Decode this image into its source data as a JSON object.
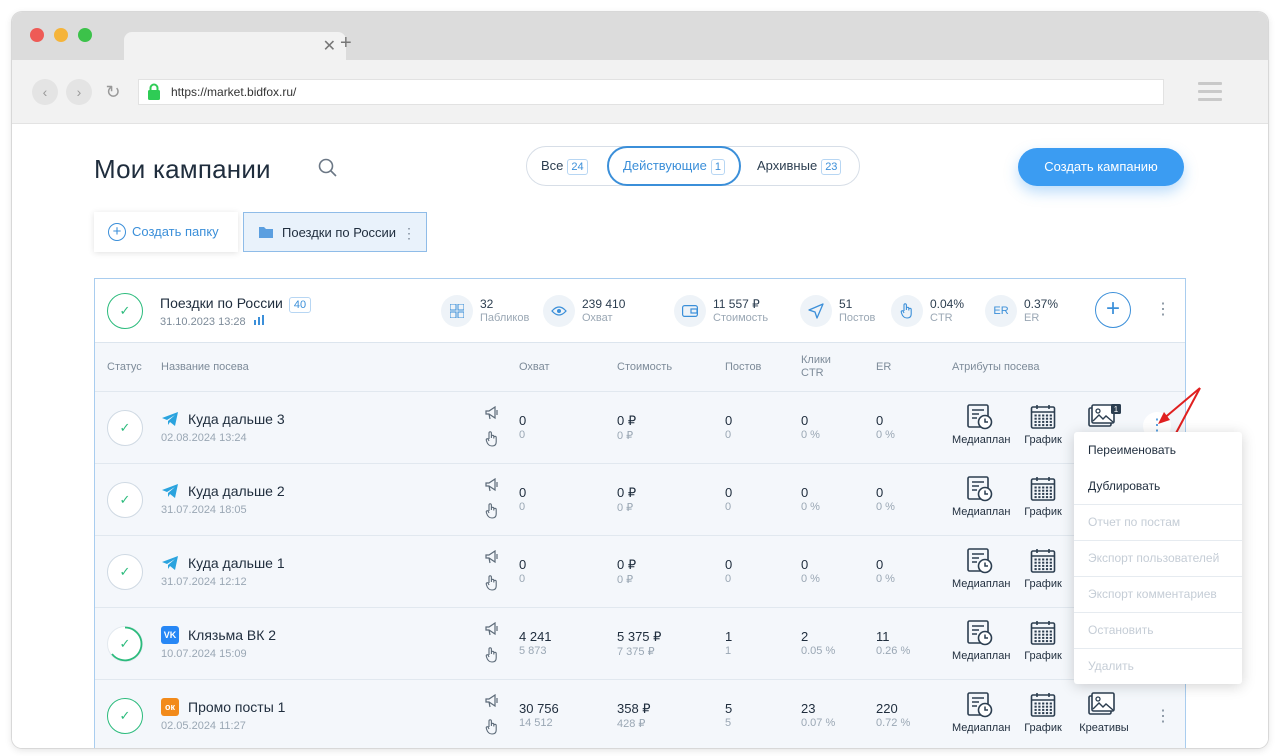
{
  "browser": {
    "url": "https://market.bidfox.ru/"
  },
  "header": {
    "title": "Мои кампании",
    "filters": [
      {
        "label": "Все",
        "count": "24"
      },
      {
        "label": "Действующие",
        "count": "1"
      },
      {
        "label": "Архивные",
        "count": "23"
      }
    ],
    "create_button": "Создать кампанию"
  },
  "folders": {
    "create_label": "Создать папку",
    "folder_label": "Поездки по России"
  },
  "campaign": {
    "name": "Поездки по России",
    "count": "40",
    "date": "31.10.2023 13:28",
    "stats": [
      {
        "icon": "grid-icon",
        "value": "32",
        "label": "Пабликов"
      },
      {
        "icon": "eye-icon",
        "value": "239 410",
        "label": "Охват"
      },
      {
        "icon": "wallet-icon",
        "value": "11 557 ₽",
        "label": "Стоимость"
      },
      {
        "icon": "send-icon",
        "value": "51",
        "label": "Постов"
      },
      {
        "icon": "hand-icon",
        "value": "0.04%",
        "label": "CTR"
      },
      {
        "icon": "er-icon",
        "value": "0.37%",
        "label": "ER",
        "badge": "ER"
      }
    ]
  },
  "table": {
    "headers": {
      "status": "Статус",
      "name": "Название посева",
      "reach": "Охват",
      "cost": "Стоимость",
      "posts": "Постов",
      "clicks": "Клики",
      "ctr": "CTR",
      "er": "ER",
      "attrs": "Атрибуты посева"
    },
    "attr_labels": {
      "mediaplan": "Медиаплан",
      "schedule": "График",
      "creatives": "Креативы"
    },
    "rows": [
      {
        "name": "Куда дальше 3",
        "date": "02.08.2024 13:24",
        "platform": "telegram",
        "reach": "0",
        "reach_sub": "0",
        "cost": "0 ₽",
        "cost_sub": "0 ₽",
        "posts": "0",
        "posts_sub": "0",
        "clicks": "0",
        "clicks_sub": "0 %",
        "er": "0",
        "er_sub": "0 %",
        "creatives_badge": "1"
      },
      {
        "name": "Куда дальше 2",
        "date": "31.07.2024 18:05",
        "platform": "telegram",
        "reach": "0",
        "reach_sub": "0",
        "cost": "0 ₽",
        "cost_sub": "0 ₽",
        "posts": "0",
        "posts_sub": "0",
        "clicks": "0",
        "clicks_sub": "0 %",
        "er": "0",
        "er_sub": "0 %"
      },
      {
        "name": "Куда дальше 1",
        "date": "31.07.2024 12:12",
        "platform": "telegram",
        "reach": "0",
        "reach_sub": "0",
        "cost": "0 ₽",
        "cost_sub": "0 ₽",
        "posts": "0",
        "posts_sub": "0",
        "clicks": "0",
        "clicks_sub": "0 %",
        "er": "0",
        "er_sub": "0 %"
      },
      {
        "name": "Клязьма ВК 2",
        "date": "10.07.2024 15:09",
        "platform": "vk",
        "platform_label": "VK",
        "reach": "4 241",
        "reach_sub": "5 873",
        "cost": "5 375 ₽",
        "cost_sub": "7 375 ₽",
        "posts": "1",
        "posts_sub": "1",
        "clicks": "2",
        "clicks_sub": "0.05 %",
        "er": "11",
        "er_sub": "0.26 %"
      },
      {
        "name": "Промо посты 1",
        "date": "02.05.2024 11:27",
        "platform": "ok",
        "platform_label": "ок",
        "reach": "30 756",
        "reach_sub": "14 512",
        "cost": "358 ₽",
        "cost_sub": "428 ₽",
        "posts": "5",
        "posts_sub": "5",
        "clicks": "23",
        "clicks_sub": "0.07 %",
        "er": "220",
        "er_sub": "0.72 %"
      }
    ]
  },
  "context_menu": {
    "items": [
      {
        "label": "Переименовать",
        "enabled": true
      },
      {
        "label": "Дублировать",
        "enabled": true
      },
      {
        "label": "Отчет по постам",
        "enabled": false
      },
      {
        "label": "Экспорт пользователей",
        "enabled": false
      },
      {
        "label": "Экспорт комментариев",
        "enabled": false
      },
      {
        "label": "Остановить",
        "enabled": false
      },
      {
        "label": "Удалить",
        "enabled": false
      }
    ]
  },
  "colors": {
    "accent": "#3b9cf2",
    "success": "#2bbb7c",
    "annotation": "#e02020",
    "telegram": "#2aa3de",
    "vk": "#2787f5",
    "ok": "#f28a1a"
  }
}
